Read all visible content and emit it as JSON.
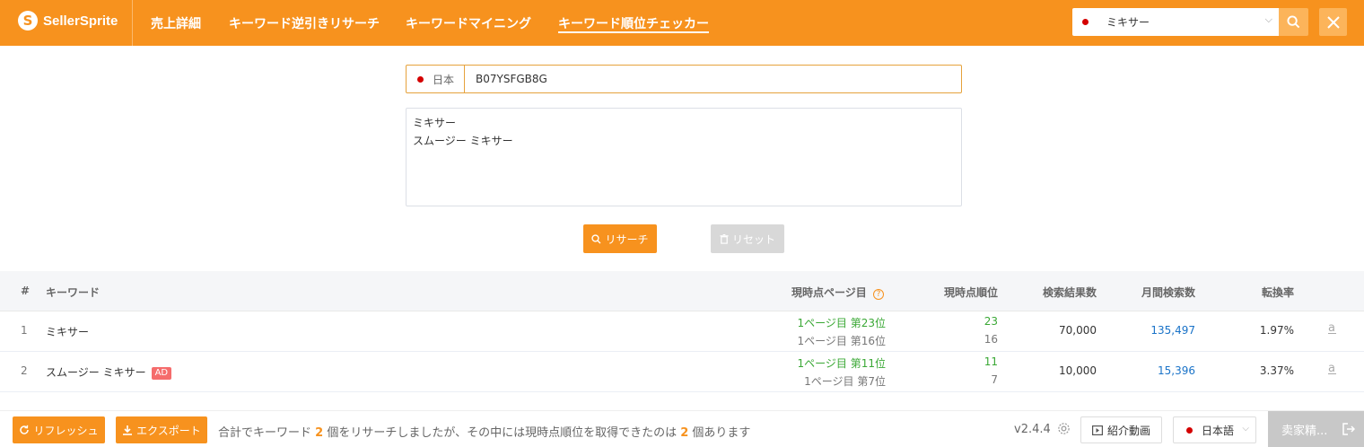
{
  "app": {
    "logo_text": "SellerSprite",
    "logo_mark": "S"
  },
  "nav": [
    {
      "label": "売上詳細"
    },
    {
      "label": "キーワード逆引きリサーチ"
    },
    {
      "label": "キーワードマイニング"
    },
    {
      "label": "キーワード順位チェッカー",
      "active": true
    }
  ],
  "header_search": {
    "value": "ミキサー",
    "marketplace_flag": "jp-flag"
  },
  "asin": {
    "marketplace": "日本",
    "value": "B07YSFGB8G"
  },
  "keywords_input": {
    "lines": [
      "ミキサー",
      "スムージー ミキサー"
    ]
  },
  "buttons": {
    "research": "リサーチ",
    "reset": "リセット",
    "refresh": "リフレッシュ",
    "export": "エクスポート",
    "intro_video": "紹介動画",
    "account": "卖家精..."
  },
  "table": {
    "headers": {
      "index": "#",
      "keyword": "キーワード",
      "current_page": "現時点ページ目",
      "current_rank": "現時点順位",
      "results": "検索結果数",
      "monthly": "月間検索数",
      "conversion": "転換率"
    },
    "rows": [
      {
        "index": "1",
        "keyword": "ミキサー",
        "ad": "",
        "page_main": "1ページ目 第23位",
        "page_sub": "1ページ目 第16位",
        "rank_main": "23",
        "rank_sub": "16",
        "results": "70,000",
        "monthly": "135,497",
        "conversion": "1.97%"
      },
      {
        "index": "2",
        "keyword": "スムージー ミキサー",
        "ad": "AD",
        "page_main": "1ページ目 第11位",
        "page_sub": "1ページ目 第7位",
        "rank_main": "11",
        "rank_sub": "7",
        "results": "10,000",
        "monthly": "15,396",
        "conversion": "3.37%"
      }
    ]
  },
  "footer": {
    "summary_pre": "合計でキーワード",
    "summary_count1": "2",
    "summary_mid": "個をリサーチしましたが、その中には現時点順位を取得できたのは",
    "summary_count2": "2",
    "summary_post": "個あります",
    "version": "v2.4.4",
    "language": "日本語"
  },
  "colors": {
    "accent": "#f7921e",
    "green": "#3aa835",
    "blue": "#1a73c8",
    "ad_badge": "#f56c6c"
  }
}
